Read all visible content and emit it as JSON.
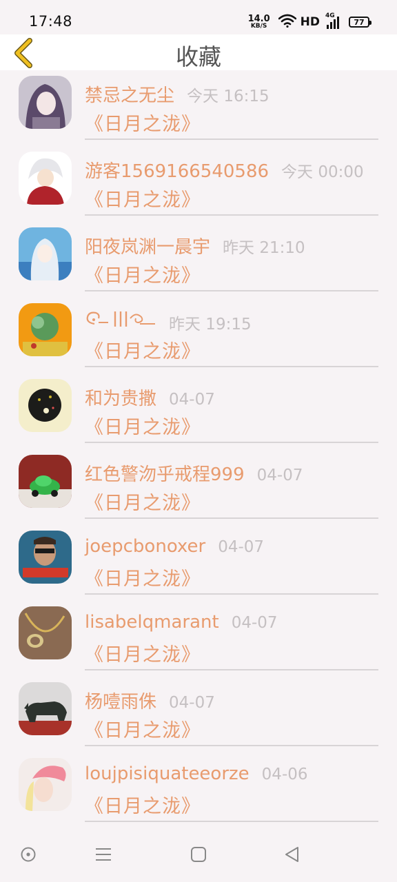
{
  "status_bar": {
    "time": "17:48",
    "net_speed_value": "14.0",
    "net_speed_unit": "KB/S",
    "network_type": "HD",
    "signal_label": "4G",
    "battery": "77"
  },
  "header": {
    "title": "收藏",
    "back_icon": "chevron-left-icon"
  },
  "items": [
    {
      "name": "禁忌之无尘",
      "time": "今天 16:15",
      "book": "《日月之泷》"
    },
    {
      "name": "游客1569166540586",
      "time": "今天 00:00",
      "book": "《日月之泷》"
    },
    {
      "name": "阳夜岚渊一晨宇",
      "time": "昨天 21:10",
      "book": "《日月之泷》"
    },
    {
      "name": "",
      "time": "昨天 19:15",
      "book": "《日月之泷》"
    },
    {
      "name": "和为贵撒",
      "time": "04-07",
      "book": "《日月之泷》"
    },
    {
      "name": "红色警沕乎戒程999",
      "time": "04-07",
      "book": "《日月之泷》"
    },
    {
      "name": "joepcbonoxer",
      "time": "04-07",
      "book": "《日月之泷》"
    },
    {
      "name": "lisabelqmarant",
      "time": "04-07",
      "book": "《日月之泷》"
    },
    {
      "name": "杨噎雨侏",
      "time": "04-07",
      "book": "《日月之泷》"
    },
    {
      "name": "loujpisiquateeorze",
      "time": "04-06",
      "book": "《日月之泷》"
    }
  ],
  "nav_bar": {
    "icons": [
      "assistant-circle-icon",
      "menu-icon",
      "home-square-icon",
      "back-triangle-icon"
    ]
  },
  "colors": {
    "accent": "#e89b6e",
    "muted": "#c5c0c2",
    "back_arrow": "#f0c020",
    "background": "#f7f3f5"
  }
}
